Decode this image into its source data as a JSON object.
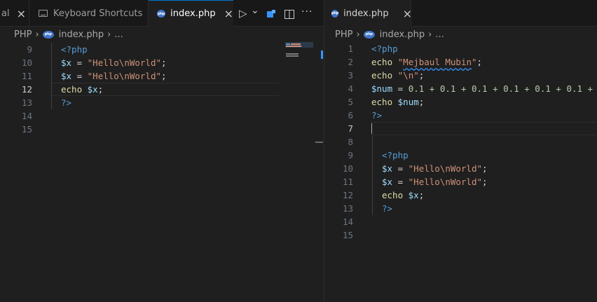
{
  "left_group": {
    "tabs": [
      {
        "label": "al"
      },
      {
        "label": "Keyboard Shortcuts"
      },
      {
        "label": "index.php",
        "active": true
      }
    ],
    "breadcrumb": {
      "folder": "PHP",
      "file": "index.php",
      "more": "..."
    },
    "line_numbers": [
      "9",
      "10",
      "11",
      "12",
      "13",
      "14",
      "15"
    ],
    "current_line": "12"
  },
  "right_group": {
    "tab": {
      "label": "index.php"
    },
    "breadcrumb": {
      "folder": "PHP",
      "file": "index.php",
      "more": "..."
    },
    "line_numbers": [
      "1",
      "2",
      "3",
      "4",
      "5",
      "6",
      "7",
      "8",
      "9",
      "10",
      "11",
      "12",
      "13",
      "14",
      "15"
    ],
    "current_line": "7"
  },
  "icons": {
    "close": "×",
    "php_badge": "php",
    "run": "▷",
    "chevron": "⌄",
    "more": "···",
    "split": "split-editor-icon"
  },
  "code": {
    "php_open": "<?php",
    "php_close": "?>",
    "echo_kw": "echo",
    "var_x": "$x",
    "var_num": "$num",
    "hello_str": "\"Hello\\nWorld\"",
    "name_str_open": "\"",
    "name_str_body": "Mejbaul Mubin",
    "newline_str": "\"\\n\"",
    "num_expr": "0.1 + 0.1 + 0.1 + 0.1 + 0.1 + 0.1 +",
    "assign": " = ",
    "semicolon": ";"
  },
  "colors": {
    "background": "#1f1f1f",
    "tab_active_border": "#0078d4",
    "keyword": "#569cd6",
    "string": "#ce9178",
    "variable": "#9cdcfe",
    "function": "#dcdcaa",
    "number": "#b5cea8"
  }
}
